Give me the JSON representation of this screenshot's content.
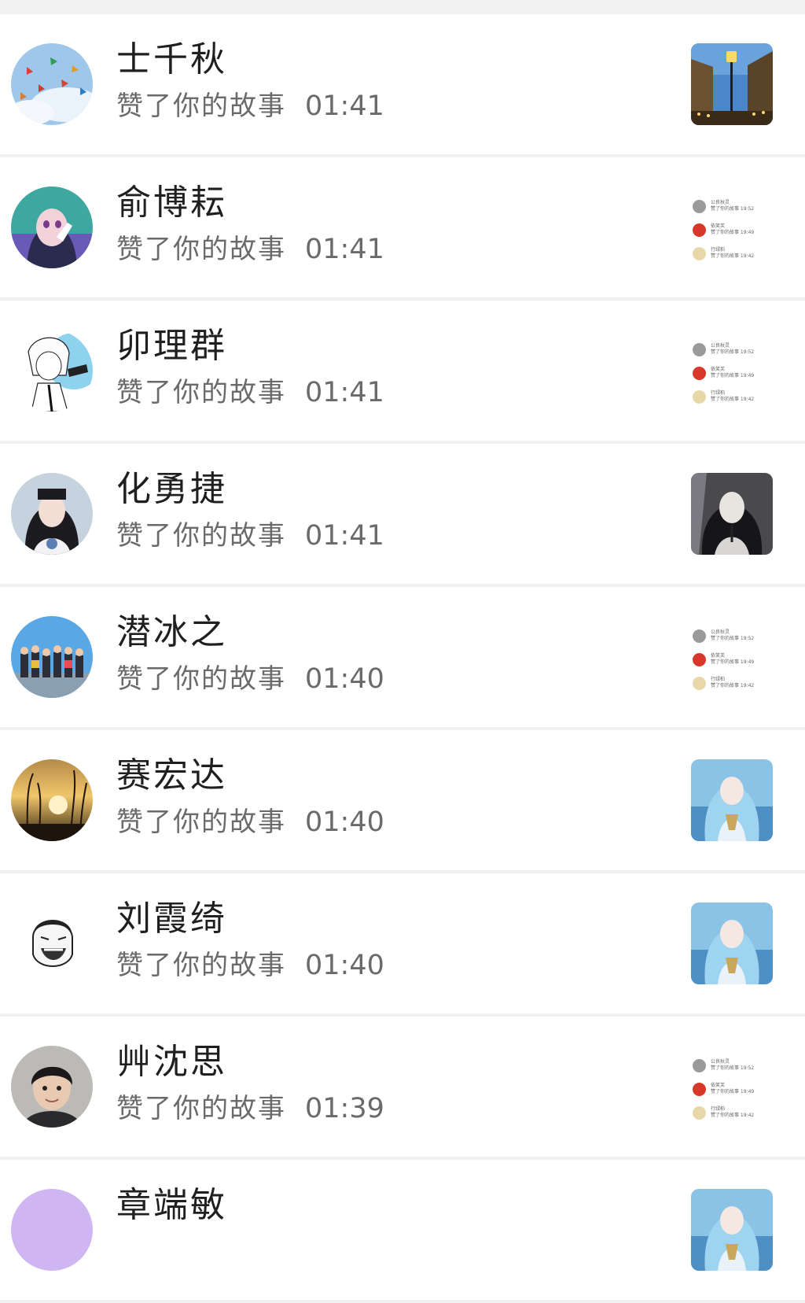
{
  "notifications": [
    {
      "name": "士千秋",
      "action": "赞了你的故事",
      "time": "01:41",
      "avatar": "paper-cranes-sky",
      "thumb": "street-lamp-night"
    },
    {
      "name": "俞博耘",
      "action": "赞了你的故事",
      "time": "01:41",
      "avatar": "anime-girl-hand-face",
      "thumb": "screenshot-list"
    },
    {
      "name": "卯理群",
      "action": "赞了你的故事",
      "time": "01:41",
      "avatar": "anime-boy-sketch",
      "thumb": "screenshot-list"
    },
    {
      "name": "化勇捷",
      "action": "赞了你的故事",
      "time": "01:41",
      "avatar": "girl-selfie",
      "thumb": "dark-anime-woman"
    },
    {
      "name": "潜冰之",
      "action": "赞了你的故事",
      "time": "01:40",
      "avatar": "group-photo-sky",
      "thumb": "screenshot-list"
    },
    {
      "name": "赛宏达",
      "action": "赞了你的故事",
      "time": "01:40",
      "avatar": "sunset-reeds",
      "thumb": "blue-hair-anime-girl"
    },
    {
      "name": "刘霞绮",
      "action": "赞了你的故事",
      "time": "01:40",
      "avatar": "laughing-meme-face",
      "thumb": "blue-hair-anime-girl"
    },
    {
      "name": "艸沈思",
      "action": "赞了你的故事",
      "time": "01:39",
      "avatar": "boy-photo",
      "thumb": "screenshot-list"
    },
    {
      "name": "章端敏",
      "action": "",
      "time": "",
      "avatar": "purple-avatar",
      "thumb": "blue-hair-anime-girl"
    }
  ],
  "mini_list": [
    {
      "name": "公良秋灵",
      "text": "赞了你的故事 19:52"
    },
    {
      "name": "依笑芙",
      "text": "赞了你的故事 19:49"
    },
    {
      "name": "行绿柏",
      "text": "赞了你的故事 19:42"
    }
  ]
}
